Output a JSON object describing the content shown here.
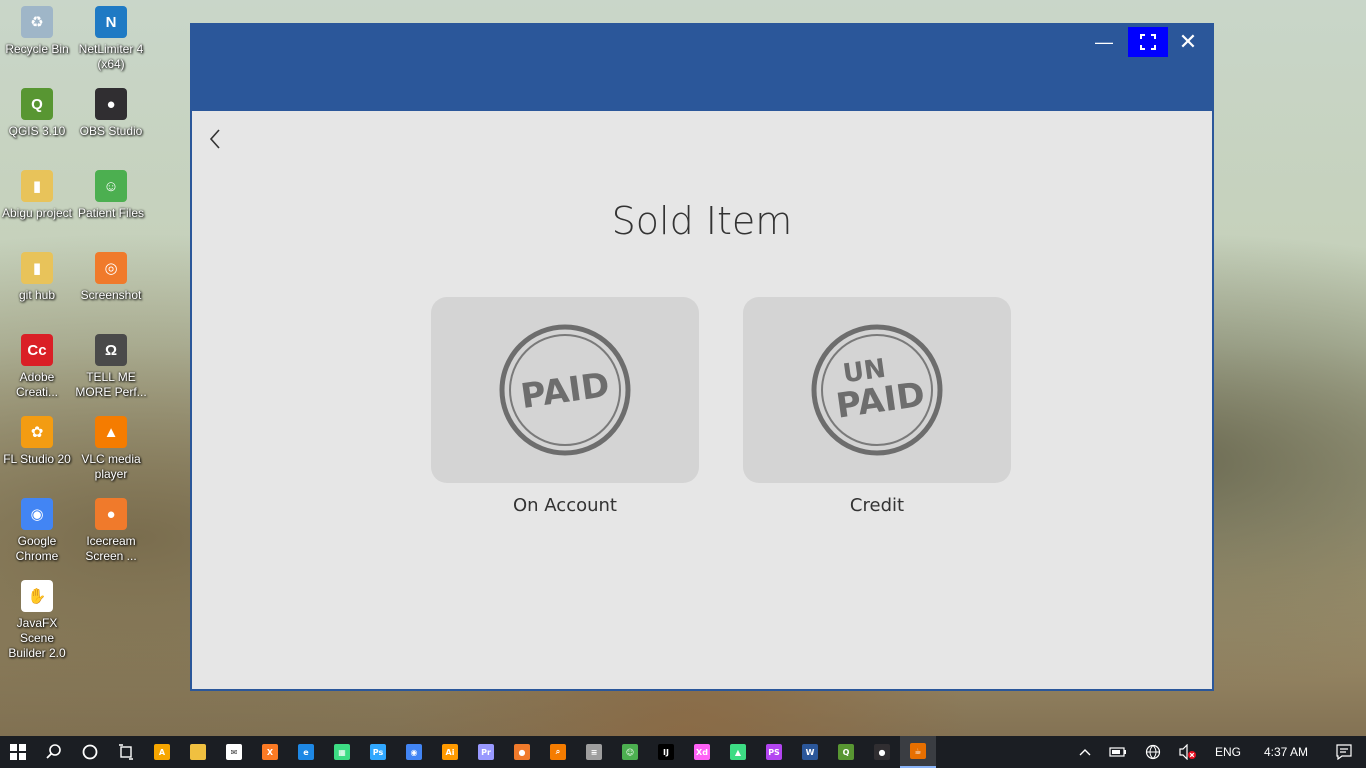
{
  "desktop": {
    "icons": [
      {
        "label": "Recycle Bin",
        "icon": "recycle-bin-icon",
        "color": "#9fb6c8",
        "glyph": "♻"
      },
      {
        "label": "NetLimiter 4 (x64)",
        "icon": "netlimiter-icon",
        "color": "#1f7ac4",
        "glyph": "N"
      },
      {
        "label": "QGIS 3.10",
        "icon": "qgis-icon",
        "color": "#589632",
        "glyph": "Q"
      },
      {
        "label": "OBS Studio",
        "icon": "obs-icon",
        "color": "#302e31",
        "glyph": "●"
      },
      {
        "label": "Abigu project",
        "icon": "folder-icon",
        "color": "#e8c35a",
        "glyph": "▮"
      },
      {
        "label": "Patient Files",
        "icon": "patient-files-icon",
        "color": "#4caf50",
        "glyph": "☺"
      },
      {
        "label": "git hub",
        "icon": "folder-icon",
        "color": "#e8c35a",
        "glyph": "▮"
      },
      {
        "label": "Screenshot",
        "icon": "screenshot-icon",
        "color": "#f07a2b",
        "glyph": "◎"
      },
      {
        "label": "Adobe Creati...",
        "icon": "adobe-cc-icon",
        "color": "#da1f26",
        "glyph": "Cc"
      },
      {
        "label": "TELL ME MORE Perf...",
        "icon": "tellmemore-icon",
        "color": "#4a4a4a",
        "glyph": "Ω"
      },
      {
        "label": "FL Studio 20",
        "icon": "fl-studio-icon",
        "color": "#f39c12",
        "glyph": "✿"
      },
      {
        "label": "VLC media player",
        "icon": "vlc-icon",
        "color": "#f57c00",
        "glyph": "▲"
      },
      {
        "label": "Google Chrome",
        "icon": "chrome-icon",
        "color": "#4285f4",
        "glyph": "◉"
      },
      {
        "label": "Icecream Screen ...",
        "icon": "icecream-icon",
        "color": "#f07a2b",
        "glyph": "●"
      },
      {
        "label": "JavaFX Scene Builder 2.0",
        "icon": "scene-builder-icon",
        "color": "#ffffff",
        "glyph": "✋"
      }
    ]
  },
  "window": {
    "minimize_glyph": "—",
    "maximize_glyph": "⛶",
    "close_glyph": "✕",
    "colors": {
      "titlebar": "#2b579a",
      "active_button": "#0000ff",
      "body": "#e6e6e6",
      "card": "#d4d4d4"
    }
  },
  "page": {
    "title": "Sold Item",
    "options": [
      {
        "stamp": "PAID",
        "caption": "On Account"
      },
      {
        "stamp_top": "UN",
        "stamp_bottom": "PAID",
        "caption": "Credit"
      }
    ]
  },
  "taskbar": {
    "apps": [
      {
        "name": "avast",
        "color": "#f7a600",
        "label": "A"
      },
      {
        "name": "file-explorer",
        "color": "#f0c040",
        "label": ""
      },
      {
        "name": "mail",
        "color": "#ffffff",
        "label": "✉"
      },
      {
        "name": "xampp",
        "color": "#fb7a24",
        "label": "X"
      },
      {
        "name": "edge",
        "color": "#1e88e5",
        "label": "e"
      },
      {
        "name": "android-app",
        "color": "#3ddc84",
        "label": "▦"
      },
      {
        "name": "photoshop",
        "color": "#31a8ff",
        "label": "Ps"
      },
      {
        "name": "chrome",
        "color": "#4285f4",
        "label": "◉"
      },
      {
        "name": "illustrator",
        "color": "#ff9a00",
        "label": "Ai"
      },
      {
        "name": "premiere",
        "color": "#9999ff",
        "label": "Pr"
      },
      {
        "name": "icecream",
        "color": "#f07a2b",
        "label": "●"
      },
      {
        "name": "search-app",
        "color": "#f57c00",
        "label": "⌕"
      },
      {
        "name": "database",
        "color": "#9e9e9e",
        "label": "≡"
      },
      {
        "name": "patient-files",
        "color": "#4caf50",
        "label": "☺"
      },
      {
        "name": "intellij",
        "color": "#000000",
        "label": "IJ"
      },
      {
        "name": "adobe-xd",
        "color": "#ff61f6",
        "label": "Xd"
      },
      {
        "name": "android-studio",
        "color": "#3ddc84",
        "label": "▲"
      },
      {
        "name": "phpstorm",
        "color": "#b345f1",
        "label": "PS"
      },
      {
        "name": "word",
        "color": "#2b579a",
        "label": "W"
      },
      {
        "name": "qgis",
        "color": "#589632",
        "label": "Q"
      },
      {
        "name": "obs",
        "color": "#302e31",
        "label": "●"
      },
      {
        "name": "java",
        "color": "#e76f00",
        "label": "☕",
        "active": true
      }
    ],
    "tray": {
      "chevron": "^",
      "language": "ENG",
      "time": "4:37 AM"
    }
  }
}
